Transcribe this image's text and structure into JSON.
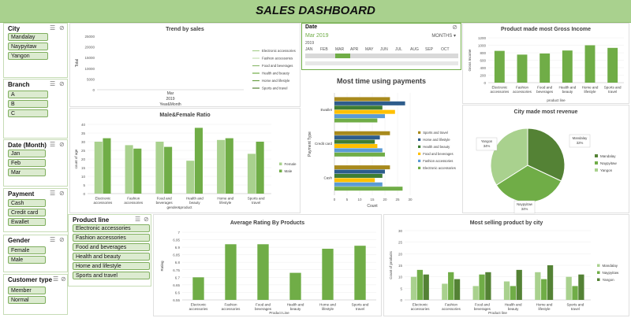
{
  "title": "SALES DASHBOARD",
  "slicers": {
    "city": {
      "header": "City",
      "items": [
        "Mandalay",
        "Naypyitaw",
        "Yangon"
      ]
    },
    "branch": {
      "header": "Branch",
      "items": [
        "A",
        "B",
        "C"
      ]
    },
    "date": {
      "header": "Date (Month)",
      "items": [
        "Jan",
        "Feb",
        "Mar"
      ]
    },
    "payment": {
      "header": "Payment",
      "items": [
        "Cash",
        "Credit card",
        "Ewallet"
      ]
    },
    "gender": {
      "header": "Gender",
      "items": [
        "Female",
        "Male"
      ]
    },
    "customer": {
      "header": "Customer type",
      "items": [
        "Member",
        "Normal"
      ]
    },
    "product": {
      "header": "Product line",
      "items": [
        "Electronic accessories",
        "Fashion accessories",
        "Food and beverages",
        "Health and beauty",
        "Home and lifestyle",
        "Sports and travel"
      ]
    }
  },
  "timeline": {
    "header": "Date",
    "selected": "Mar 2019",
    "level": "MONTHS",
    "year": "2019",
    "months": [
      "JAN",
      "FEB",
      "MAR",
      "APR",
      "MAY",
      "JUN",
      "JUL",
      "AUG",
      "SEP",
      "OCT"
    ],
    "selected_index": 2
  },
  "colors": {
    "accent": "#70ad47",
    "light": "#a9d18e",
    "dark": "#548235",
    "title_bg": "#a9d18e",
    "pay_colors": [
      "#a88a1d",
      "#2e5d8c",
      "#3e7d33",
      "#ffc000",
      "#5b9bd5",
      "#70ad47"
    ]
  },
  "chart_data": [
    {
      "id": "trend",
      "type": "line",
      "title": "Trend by sales",
      "ylabel": "Total",
      "xlabel": "Year&Month",
      "x_ticks": [
        "Mar",
        "2019"
      ],
      "y_ticks": [
        0,
        5000,
        10000,
        15000,
        20000,
        25000
      ],
      "ylim": [
        0,
        25000
      ],
      "series": [
        {
          "name": "Electronic accessories"
        },
        {
          "name": "Fashion accessories"
        },
        {
          "name": "Food and beverages"
        },
        {
          "name": "Health and beauty"
        },
        {
          "name": "Home and lifestyle"
        },
        {
          "name": "Sports and travel"
        }
      ]
    },
    {
      "id": "gross",
      "type": "bar",
      "title": "Product made most Gross Income",
      "ylabel": "Gross Income",
      "xlabel": "product line",
      "categories": [
        "Electronic accessories",
        "Fashion accessories",
        "Food and beverages",
        "Health and beauty",
        "Home and lifestyle",
        "Sports and travel"
      ],
      "values": [
        850,
        750,
        780,
        860,
        1000,
        930
      ],
      "ylim": [
        0,
        1200
      ],
      "y_ticks": [
        0,
        200,
        400,
        600,
        800,
        1000,
        1200
      ]
    },
    {
      "id": "gender",
      "type": "bar",
      "title": "Male&Female Ratio",
      "ylabel": "count of age",
      "xlabel": "gender&product",
      "categories": [
        "Electronic accessories",
        "Fashion accessories",
        "Food and beverages",
        "Health and beauty",
        "Home and lifestyle",
        "Sports and travel"
      ],
      "series": [
        {
          "name": "Female",
          "values": [
            30,
            28,
            30,
            19,
            31,
            23
          ]
        },
        {
          "name": "Male",
          "values": [
            32,
            26,
            27,
            38,
            32,
            30
          ]
        }
      ],
      "ylim": [
        0,
        40
      ],
      "y_ticks": [
        0,
        5,
        10,
        15,
        20,
        25,
        30,
        35,
        40
      ],
      "legend": "right"
    },
    {
      "id": "payment",
      "type": "bar",
      "title": "Most time using payments",
      "ylabel": "Payment Type",
      "xlabel": "Count",
      "categories": [
        "Cash",
        "Credit card",
        "Ewallet"
      ],
      "series": [
        {
          "name": "Sports and travel",
          "values": [
            22,
            22,
            22
          ]
        },
        {
          "name": "Home and lifestyle",
          "values": [
            20,
            18,
            28
          ]
        },
        {
          "name": "Health and beauty",
          "values": [
            19,
            16,
            19
          ]
        },
        {
          "name": "Food and beverages",
          "values": [
            16,
            17,
            24
          ]
        },
        {
          "name": "Fashion accessories",
          "values": [
            19,
            19,
            20
          ]
        },
        {
          "name": "Electronic accessories",
          "values": [
            27,
            20,
            17
          ]
        }
      ],
      "xlim": [
        0,
        30
      ],
      "x_ticks": [
        0,
        5,
        10,
        15,
        20,
        25,
        30
      ],
      "legend": "right"
    },
    {
      "id": "city_pie",
      "type": "pie",
      "title": "City made most revenue",
      "labels": [
        "Mandalay",
        "Naypyitaw",
        "Yangon"
      ],
      "values": [
        32,
        34,
        34
      ],
      "value_labels": [
        "Mandalay\n32%",
        "Naypyitaw\n34%",
        "Yangon\n34%"
      ],
      "legend": "right"
    },
    {
      "id": "rating",
      "type": "bar",
      "title": "Average Rating By Products",
      "ylabel": "Rating",
      "xlabel": "Product Line",
      "categories": [
        "Electronic accessories",
        "Fashion accessories",
        "Food and beverages",
        "Health and beauty",
        "Home and lifestyle",
        "Sports and travel"
      ],
      "values": [
        6.7,
        6.92,
        6.92,
        6.73,
        6.89,
        6.91
      ],
      "ylim": [
        6.55,
        7
      ],
      "y_ticks": [
        6.55,
        6.6,
        6.65,
        6.7,
        6.75,
        6.8,
        6.85,
        6.9,
        6.95,
        7
      ]
    },
    {
      "id": "city_product",
      "type": "bar",
      "title": "Most selling product by city",
      "ylabel": "Count of products",
      "xlabel": "Product line",
      "categories": [
        "Electronic accessories",
        "Fashion accessories",
        "Food and beverages",
        "Health and beauty",
        "Home and lifestyle",
        "Sports and travel"
      ],
      "series": [
        {
          "name": "Mandalay",
          "values": [
            10,
            7,
            6,
            8,
            12,
            10
          ]
        },
        {
          "name": "Naypyitaw",
          "values": [
            13,
            12,
            11,
            6,
            9,
            6
          ]
        },
        {
          "name": "Yangon",
          "values": [
            11,
            9,
            12,
            13,
            15,
            11
          ]
        }
      ],
      "ylim": [
        0,
        30
      ],
      "y_ticks": [
        0,
        5,
        10,
        15,
        20,
        25,
        30
      ],
      "legend": "right"
    }
  ]
}
